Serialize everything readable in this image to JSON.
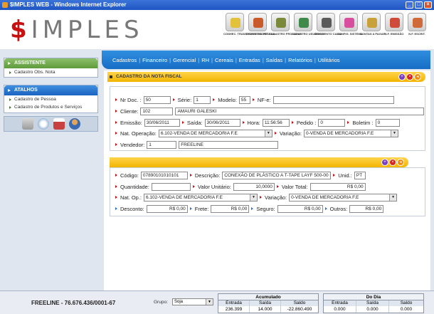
{
  "window": {
    "title": "$IMPLES WEB - Windows Internet Explorer"
  },
  "logo": {
    "dollar": "$",
    "text": "IMPLES"
  },
  "toolbar": [
    {
      "label": "CONHEC. TRANSPORTE ESCRIT.",
      "color": "#e2c23a"
    },
    {
      "label": "CADASTRO PESSOA",
      "color": "#c95a2a"
    },
    {
      "label": "CADASTRO PRODUTOS",
      "color": "#7b8a3a"
    },
    {
      "label": "CADASTRO USUÁRIOS",
      "color": "#3f8a4a"
    },
    {
      "label": "MOVIMENTO CAIXA",
      "color": "#5a5a5a"
    },
    {
      "label": "CONFIG. SISTEMA",
      "color": "#d94fa0"
    },
    {
      "label": "CONTAS A PAGAR",
      "color": "#c9a13a"
    },
    {
      "label": "N.F. EMISSÃO",
      "color": "#d04a3a"
    },
    {
      "label": "N.F. ESCRIT.",
      "color": "#d06a3a"
    }
  ],
  "assistente": {
    "title": "ASSISTENTE",
    "items": [
      "Cadastro Obs. Nota"
    ]
  },
  "atalhos": {
    "title": "ATALHOS",
    "items": [
      "Cadastro de Pessoa",
      "Cadastro de Produtos e Serviços"
    ]
  },
  "quick_icons": [
    "calculator-icon",
    "search-icon",
    "calendar-icon",
    "user-icon"
  ],
  "menu": [
    "Cadastros",
    "Financeiro",
    "Gerencial",
    "RH",
    "Cereais",
    "Entradas",
    "Saídas",
    "Relatórios",
    "Utilitários"
  ],
  "section": {
    "title": "CADASTRO DA NOTA FISCAL"
  },
  "nota": {
    "nr_doc_label": "Nr Doc. :",
    "nr_doc": "50",
    "serie_label": "Série:",
    "serie": "1",
    "modelo_label": "Modelo:",
    "modelo": "55",
    "nfe_label": "NF-e:",
    "nfe": "",
    "cliente_label": "Cliente:",
    "cliente_cod": "102",
    "cliente_nome": "AMAURI GALESKI",
    "emissao_label": "Emissão:",
    "emissao": "30/06/2011",
    "saida_label": "Saída:",
    "saida": "30/06/2011",
    "hora_label": "Hora:",
    "hora": "11:56:56",
    "pedido_label": "Pedido :",
    "pedido": "0",
    "boletim_label": "Boletim :",
    "boletim": "0",
    "natop_label": "Nat. Operação:",
    "natop": "6.102-VENDA DE MERCADORIA F.E",
    "variacao_label": "Variação:",
    "variacao": "0-VENDA DE MERCADORIA F.E",
    "vendedor_label": "Vendedor:",
    "vendedor_cod": "1",
    "vendedor_nome": "FREELINE"
  },
  "item": {
    "codigo_label": "Código:",
    "codigo": "07890101010101",
    "descricao_label": "Descrição:",
    "descricao": "CONEXÃO DE PLÁSTICO A T-TAPE LAYF 500-00 LF",
    "unid_label": "Unid.:",
    "unid": "PT",
    "quantidade_label": "Quantidade:",
    "quantidade": "",
    "valor_unitario_label": "Valor Unitário:",
    "valor_unitario": "10,0000",
    "valor_total_label": "Valor Total:",
    "valor_total": "R$ 0,00",
    "natop_label": "Nat. Op.:",
    "natop": "6.102-VENDA DE MERCADORIA F.E",
    "variacao_label": "Variação:",
    "variacao": "0-VENDA DE MERCADORIA F.E",
    "desconto_label": "Desconto:",
    "desconto": "R$ 0,00",
    "frete_label": "Frete:",
    "frete": "R$ 0,00",
    "seguro_label": "Seguro:",
    "seguro": "R$ 0,00",
    "outros_label": "Outros:",
    "outros": "R$ 0,00"
  },
  "footer": {
    "brand": "FREELINE - 76.676.436/0001-67",
    "grupo_label": "Grupo:",
    "grupo": "Soja",
    "acumulado": {
      "title": "Acumulado",
      "entrada_label": "Entrada",
      "saida_label": "Saída",
      "saldo_label": "Saldo",
      "entrada": "236.399",
      "saida": "14.000",
      "saldo": "-22.860.490"
    },
    "dia": {
      "title": "Do Dia",
      "entrada_label": "Entrada",
      "saida_label": "Saída",
      "saldo_label": "Saldo",
      "entrada": "0.000",
      "saida": "0.000",
      "saldo": "0.000"
    }
  }
}
